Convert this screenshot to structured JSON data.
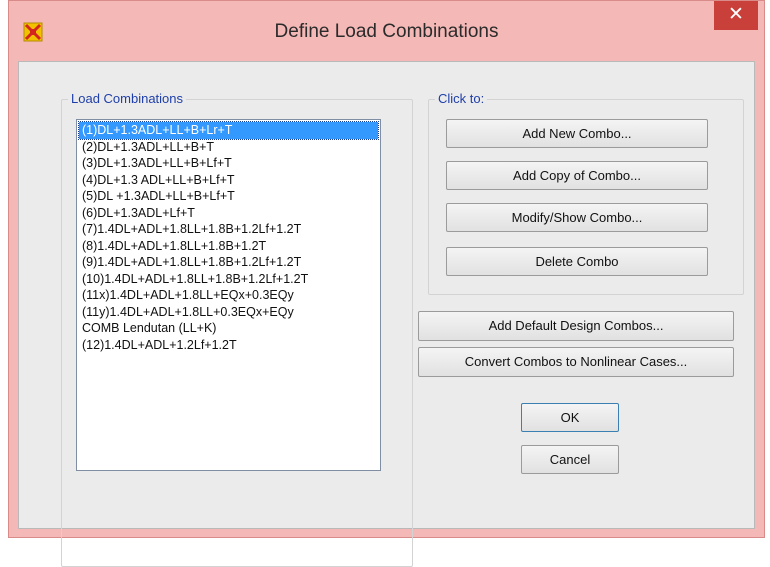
{
  "window": {
    "title": "Define Load Combinations",
    "close_glyph": "✕"
  },
  "load_combinations": {
    "legend": "Load Combinations",
    "items": [
      "(1)DL+1.3ADL+LL+B+Lr+T",
      "(2)DL+1.3ADL+LL+B+T",
      "(3)DL+1.3ADL+LL+B+Lf+T",
      "(4)DL+1.3 ADL+LL+B+Lf+T",
      "(5)DL +1.3ADL+LL+B+Lf+T",
      "(6)DL+1.3ADL+Lf+T",
      "(7)1.4DL+ADL+1.8LL+1.8B+1.2Lf+1.2T",
      "(8)1.4DL+ADL+1.8LL+1.8B+1.2T",
      "(9)1.4DL+ADL+1.8LL+1.8B+1.2Lf+1.2T",
      "(10)1.4DL+ADL+1.8LL+1.8B+1.2Lf+1.2T",
      "(11x)1.4DL+ADL+1.8LL+EQx+0.3EQy",
      "(11y)1.4DL+ADL+1.8LL+0.3EQx+EQy",
      "COMB Lendutan (LL+K)",
      "(12)1.4DL+ADL+1.2Lf+1.2T"
    ],
    "selected_index": 0
  },
  "click_to": {
    "legend": "Click to:",
    "add_new": "Add New Combo...",
    "add_copy": "Add Copy of Combo...",
    "modify_show": "Modify/Show Combo...",
    "delete": "Delete Combo"
  },
  "buttons": {
    "add_default": "Add Default Design Combos...",
    "convert": "Convert Combos to Nonlinear Cases...",
    "ok": "OK",
    "cancel": "Cancel"
  },
  "colors": {
    "title_bar": "#f4b9b7",
    "close_button": "#c9403a",
    "selection": "#3399ff",
    "legend_text": "#1f3fa8"
  }
}
